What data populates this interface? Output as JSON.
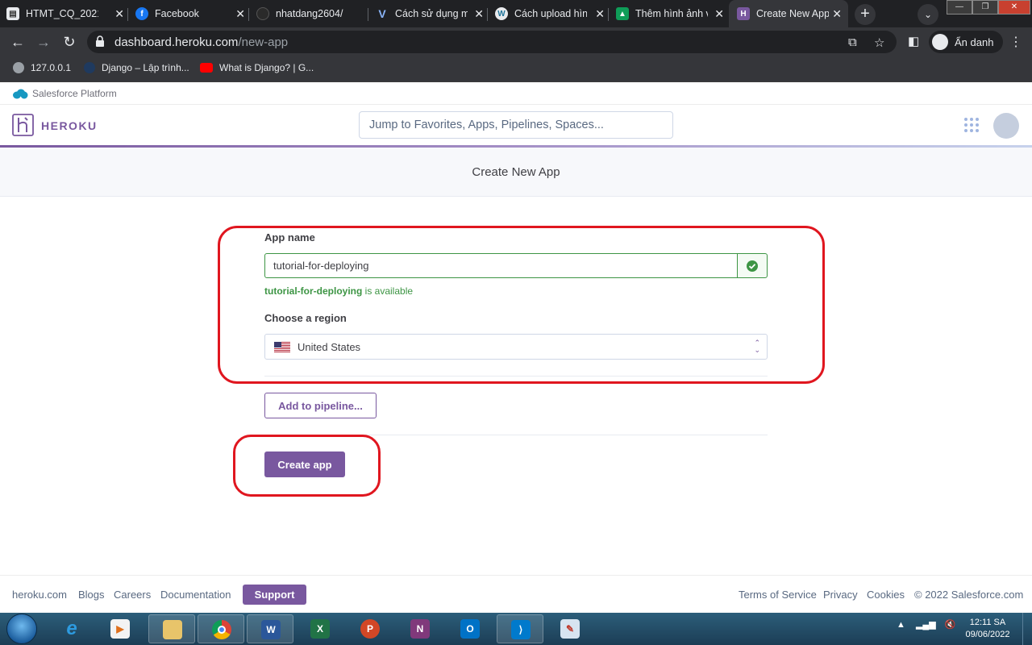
{
  "browser": {
    "tabs": [
      {
        "title": "HTMT_CQ_2021",
        "icon": "document-icon",
        "active": false
      },
      {
        "title": "Facebook",
        "icon": "facebook-icon",
        "active": false
      },
      {
        "title": "nhatdang2604/",
        "icon": "github-icon",
        "active": false
      },
      {
        "title": "Cách sử dụng m",
        "icon": "vue-icon",
        "active": false
      },
      {
        "title": "Cách upload hìn",
        "icon": "wordpress-icon",
        "active": false
      },
      {
        "title": "Thêm hình ảnh v",
        "icon": "image-site-icon",
        "active": false
      },
      {
        "title": "Create New App",
        "icon": "heroku-tab-icon",
        "active": true
      }
    ],
    "url_host": "dashboard.heroku.com",
    "url_path": "/new-app",
    "profile_label": "Ẩn danh",
    "bookmarks": [
      {
        "label": "127.0.0.1",
        "icon": "globe-icon"
      },
      {
        "label": "Django – Lập trình...",
        "icon": "django-icon"
      },
      {
        "label": "What is Django? | G...",
        "icon": "youtube-icon"
      }
    ]
  },
  "page": {
    "platform_label": "Salesforce Platform",
    "brand": "HEROKU",
    "search_placeholder": "Jump to Favorites, Apps, Pipelines, Spaces...",
    "title": "Create New App",
    "form": {
      "app_name_label": "App name",
      "app_name_value": "tutorial-for-deploying",
      "availability_name": "tutorial-for-deploying",
      "availability_suffix": " is available",
      "region_label": "Choose a region",
      "region_value": "United States",
      "pipeline_button": "Add to pipeline...",
      "create_button": "Create app"
    },
    "footer": {
      "left_links": [
        "heroku.com",
        "Blogs",
        "Careers",
        "Documentation"
      ],
      "support_button": "Support",
      "right_links": [
        "Terms of Service",
        "Privacy",
        "Cookies",
        "© 2022 Salesforce.com"
      ]
    },
    "colors": {
      "brand_purple": "#79589f",
      "success_green": "#3d9544",
      "highlight_red": "#e0161f"
    }
  },
  "taskbar": {
    "apps": [
      "file-explorer-icon",
      "chrome-icon",
      "word-icon",
      "excel-icon",
      "powerpoint-icon",
      "onenote-icon",
      "outlook-icon",
      "vscode-icon",
      "paint-icon"
    ],
    "time": "12:11 SA",
    "date": "09/06/2022"
  }
}
